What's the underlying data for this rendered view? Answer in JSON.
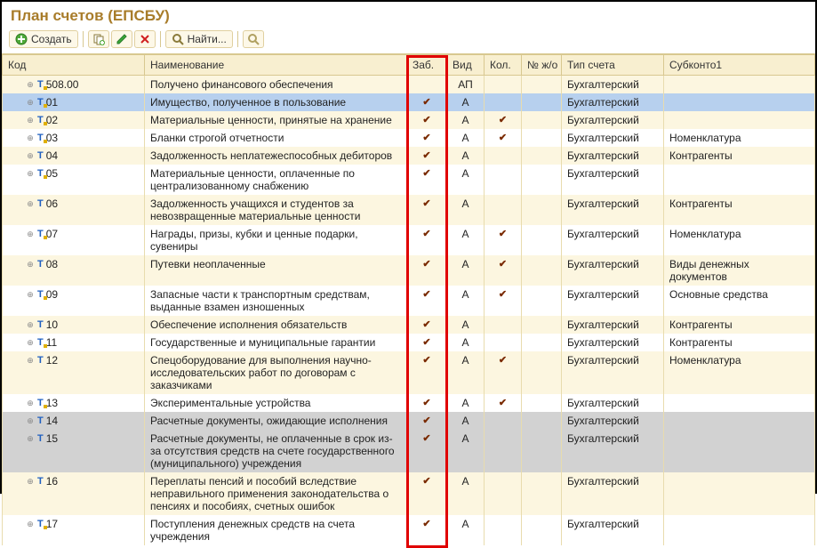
{
  "title": "План счетов (ЕПСБУ)",
  "toolbar": {
    "create_label": "Создать",
    "find_label": "Найти..."
  },
  "columns": {
    "code": "Код",
    "name": "Наименование",
    "zab": "Заб.",
    "vid": "Вид",
    "kol": "Кол.",
    "njo": "№ ж/о",
    "type": "Тип счета",
    "sub1": "Субконто1"
  },
  "rows": [
    {
      "code": "508.00",
      "icon": "y",
      "name": "Получено финансового обеспечения",
      "zab": false,
      "vid": "АП",
      "kol": false,
      "type": "Бухгалтерский",
      "sub": "",
      "state": "odd"
    },
    {
      "code": "01",
      "icon": "y",
      "name": "Имущество, полученное в пользование",
      "zab": true,
      "vid": "А",
      "kol": false,
      "type": "Бухгалтерский",
      "sub": "",
      "state": "sel"
    },
    {
      "code": "02",
      "icon": "y",
      "name": "Материальные ценности, принятые на хранение",
      "zab": true,
      "vid": "А",
      "kol": true,
      "type": "Бухгалтерский",
      "sub": "",
      "state": "odd"
    },
    {
      "code": "03",
      "icon": "y",
      "name": "Бланки строгой отчетности",
      "zab": true,
      "vid": "А",
      "kol": true,
      "type": "Бухгалтерский",
      "sub": "Номенклатура",
      "state": ""
    },
    {
      "code": "04",
      "icon": "b",
      "name": "Задолженность неплатежеспособных дебиторов",
      "zab": true,
      "vid": "А",
      "kol": false,
      "type": "Бухгалтерский",
      "sub": "Контрагенты",
      "state": "odd"
    },
    {
      "code": "05",
      "icon": "y",
      "name": "Материальные ценности, оплаченные по централизованному снабжению",
      "zab": true,
      "vid": "А",
      "kol": false,
      "type": "Бухгалтерский",
      "sub": "",
      "state": ""
    },
    {
      "code": "06",
      "icon": "b",
      "name": "Задолженность учащихся и студентов за невозвращенные материальные ценности",
      "zab": true,
      "vid": "А",
      "kol": false,
      "type": "Бухгалтерский",
      "sub": "Контрагенты",
      "state": "odd"
    },
    {
      "code": "07",
      "icon": "y",
      "name": "Награды, призы, кубки и ценные подарки, сувениры",
      "zab": true,
      "vid": "А",
      "kol": true,
      "type": "Бухгалтерский",
      "sub": "Номенклатура",
      "state": ""
    },
    {
      "code": "08",
      "icon": "b",
      "name": "Путевки неоплаченные",
      "zab": true,
      "vid": "А",
      "kol": true,
      "type": "Бухгалтерский",
      "sub": "Виды денежных документов",
      "state": "odd"
    },
    {
      "code": "09",
      "icon": "y",
      "name": "Запасные части к транспортным средствам, выданные взамен изношенных",
      "zab": true,
      "vid": "А",
      "kol": true,
      "type": "Бухгалтерский",
      "sub": "Основные средства",
      "state": ""
    },
    {
      "code": "10",
      "icon": "b",
      "name": "Обеспечение исполнения обязательств",
      "zab": true,
      "vid": "А",
      "kol": false,
      "type": "Бухгалтерский",
      "sub": "Контрагенты",
      "state": "odd"
    },
    {
      "code": "11",
      "icon": "y",
      "name": "Государственные и муниципальные гарантии",
      "zab": true,
      "vid": "А",
      "kol": false,
      "type": "Бухгалтерский",
      "sub": "Контрагенты",
      "state": ""
    },
    {
      "code": "12",
      "icon": "b",
      "name": "Спецоборудование для выполнения научно-исследовательских работ по договорам с заказчиками",
      "zab": true,
      "vid": "А",
      "kol": true,
      "type": "Бухгалтерский",
      "sub": "Номенклатура",
      "state": "odd"
    },
    {
      "code": "13",
      "icon": "y",
      "name": "Экспериментальные устройства",
      "zab": true,
      "vid": "А",
      "kol": true,
      "type": "Бухгалтерский",
      "sub": "",
      "state": ""
    },
    {
      "code": "14",
      "icon": "b",
      "name": "Расчетные документы, ожидающие исполнения",
      "zab": true,
      "vid": "А",
      "kol": false,
      "type": "Бухгалтерский",
      "sub": "",
      "state": "grey"
    },
    {
      "code": "15",
      "icon": "b",
      "name": "Расчетные документы, не оплаченные в срок из-за отсутствия средств на счете государственного (муниципального) учреждения",
      "zab": true,
      "vid": "А",
      "kol": false,
      "type": "Бухгалтерский",
      "sub": "",
      "state": "grey"
    },
    {
      "code": "16",
      "icon": "b",
      "name": "Переплаты пенсий и пособий вследствие неправильного применения законодательства о пенсиях и пособиях, счетных ошибок",
      "zab": true,
      "vid": "А",
      "kol": false,
      "type": "Бухгалтерский",
      "sub": "",
      "state": "odd"
    },
    {
      "code": "17",
      "icon": "y",
      "name": "Поступления денежных средств на счета учреждения",
      "zab": true,
      "vid": "А",
      "kol": false,
      "type": "Бухгалтерский",
      "sub": "",
      "state": ""
    }
  ]
}
